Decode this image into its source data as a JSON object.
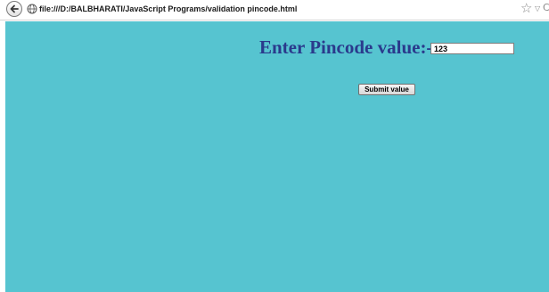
{
  "browser": {
    "address": "file:///D:/BALBHARATI/JavaScript Programs/validation pincode.html",
    "icons": {
      "back": "back-arrow-icon",
      "site": "globe-icon",
      "bookmark": "star-icon",
      "dropdown": "chevron-down-icon",
      "reload": "reload-icon"
    }
  },
  "page": {
    "background": "#56c4d0",
    "label": "Enter Pincode value:-",
    "label_color": "#2a3a8c",
    "pincode_value": "123",
    "submit_label": "Submit value"
  }
}
